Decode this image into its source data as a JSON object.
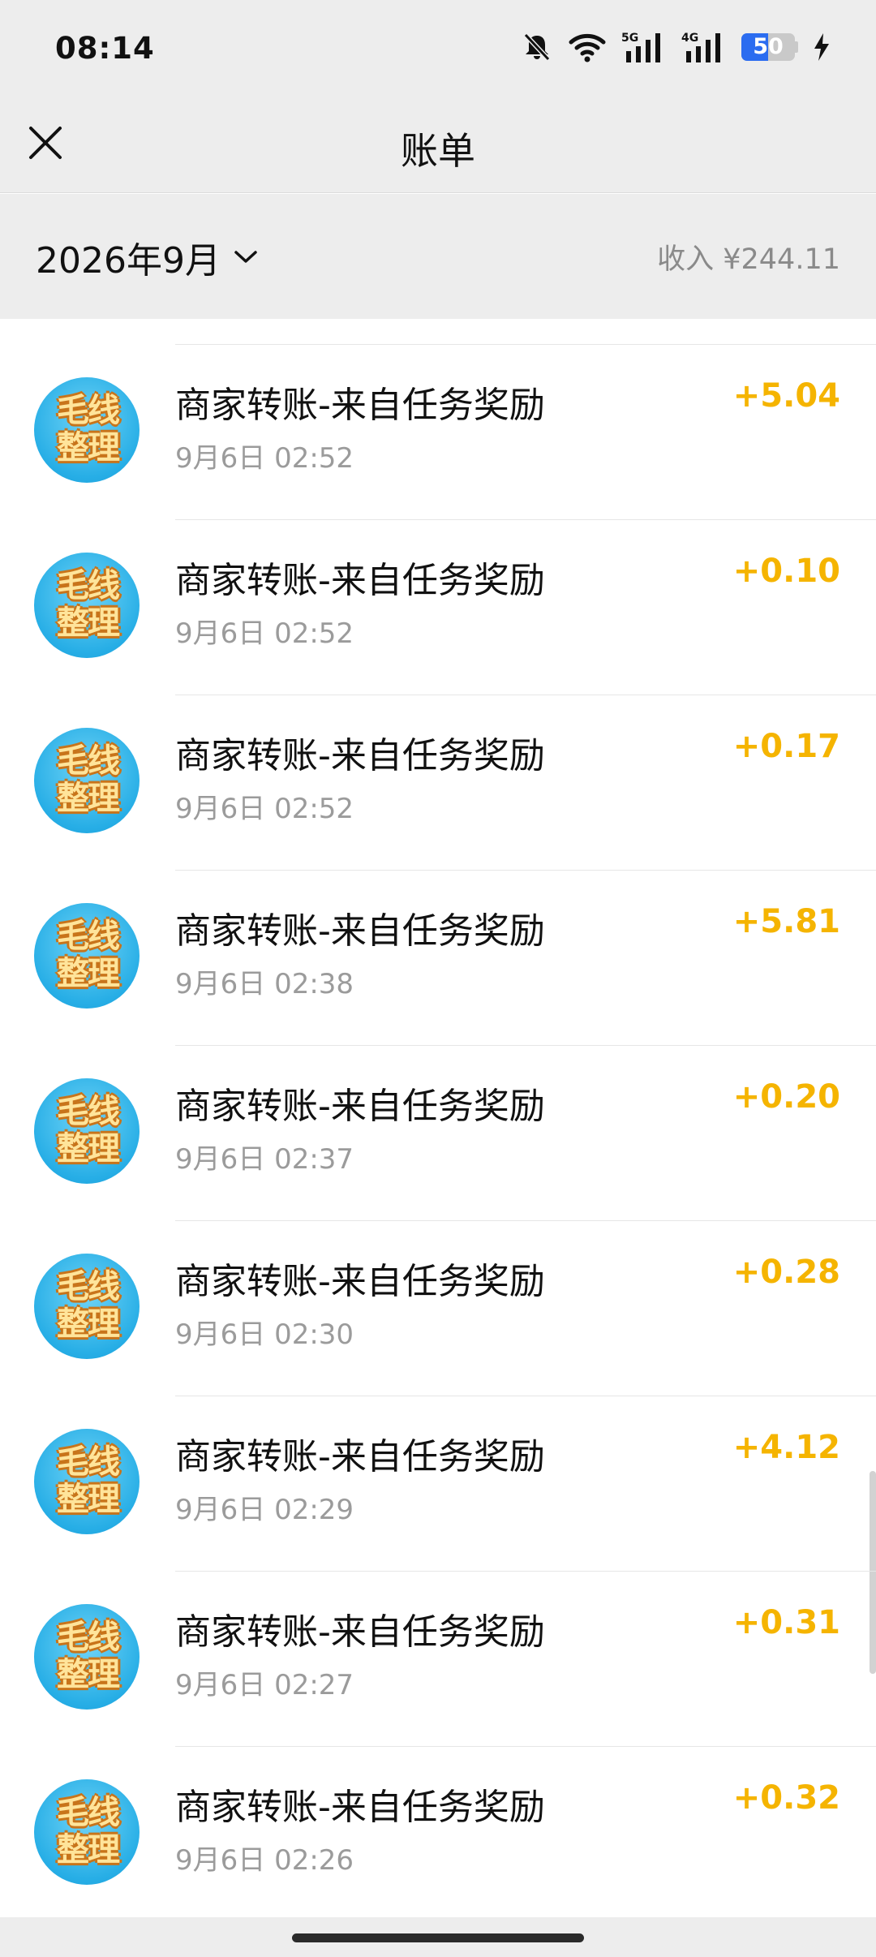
{
  "status_bar": {
    "time": "08:14",
    "icons": [
      "bell-muted-icon",
      "wifi-icon",
      "signal-5g-icon",
      "signal-4g-icon",
      "battery-icon",
      "charging-icon"
    ],
    "net1": "5G",
    "net2": "4G",
    "battery_level": "50"
  },
  "nav": {
    "title": "账单",
    "close_icon": "close-icon"
  },
  "filter": {
    "month": "2026年9月",
    "income": "收入 ¥244.11"
  },
  "list": {
    "items": [
      {
        "title": "商家转账-来自任务奖励",
        "time": "9月6日 02:52",
        "amount": "+5.04",
        "avatar_text": "毛线整理"
      },
      {
        "title": "商家转账-来自任务奖励",
        "time": "9月6日 02:52",
        "amount": "+0.10",
        "avatar_text": "毛线整理"
      },
      {
        "title": "商家转账-来自任务奖励",
        "time": "9月6日 02:52",
        "amount": "+0.17",
        "avatar_text": "毛线整理"
      },
      {
        "title": "商家转账-来自任务奖励",
        "time": "9月6日 02:38",
        "amount": "+5.81",
        "avatar_text": "毛线整理"
      },
      {
        "title": "商家转账-来自任务奖励",
        "time": "9月6日 02:37",
        "amount": "+0.20",
        "avatar_text": "毛线整理"
      },
      {
        "title": "商家转账-来自任务奖励",
        "time": "9月6日 02:30",
        "amount": "+0.28",
        "avatar_text": "毛线整理"
      },
      {
        "title": "商家转账-来自任务奖励",
        "time": "9月6日 02:29",
        "amount": "+4.12",
        "avatar_text": "毛线整理"
      },
      {
        "title": "商家转账-来自任务奖励",
        "time": "9月6日 02:27",
        "amount": "+0.31",
        "avatar_text": "毛线整理"
      },
      {
        "title": "商家转账-来自任务奖励",
        "time": "9月6日 02:26",
        "amount": "+0.32",
        "avatar_text": "毛线整理"
      }
    ]
  },
  "colors": {
    "amount": "#f5b400",
    "background": "#ededed",
    "battery": "#2b6cf0"
  }
}
